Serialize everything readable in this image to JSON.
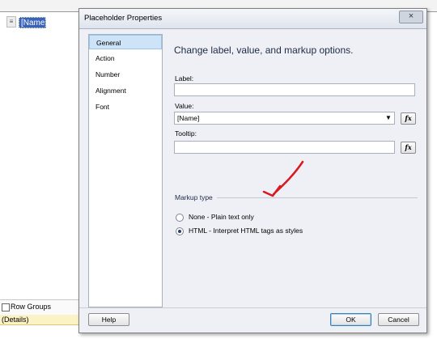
{
  "background": {
    "handle_glyph": "≡",
    "selected_cell": "[Name]",
    "row_groups_label": "Row Groups",
    "details_label": "(Details)"
  },
  "dialog": {
    "title": "Placeholder Properties",
    "close_glyph": "×",
    "nav": {
      "items": [
        {
          "label": "General",
          "active": true
        },
        {
          "label": "Action"
        },
        {
          "label": "Number"
        },
        {
          "label": "Alignment"
        },
        {
          "label": "Font"
        }
      ]
    },
    "heading": "Change label, value, and markup options.",
    "label_field": {
      "label": "Label:",
      "value": ""
    },
    "value_field": {
      "label": "Value:",
      "value": "[Name]"
    },
    "tooltip_field": {
      "label": "Tooltip:",
      "value": ""
    },
    "fx_glyph": "fx",
    "combo_arrow_glyph": "▼",
    "markup_type": {
      "title": "Markup type",
      "options": [
        {
          "label": "None - Plain text only",
          "selected": false
        },
        {
          "label": "HTML - Interpret HTML tags as styles",
          "selected": true
        }
      ]
    },
    "buttons": {
      "help": "Help",
      "ok": "OK",
      "cancel": "Cancel"
    },
    "annotation": {
      "color": "#d8191f",
      "icon": "hand-drawn-arrow"
    }
  }
}
